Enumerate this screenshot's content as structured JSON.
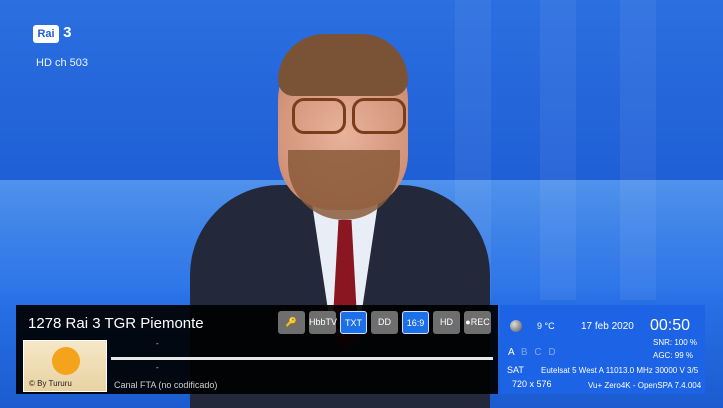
{
  "channel_logo": {
    "brand": "Rai",
    "number": "3"
  },
  "hd_channel": "HD ch 503",
  "infobar": {
    "channel": "1278 Rai 3 TGR Piemonte",
    "now": "-",
    "next": "-",
    "encryption": "Canal FTA (no codificado)",
    "picon_credit": "© By Tururu",
    "progress_fraction": 0.0,
    "icons": [
      {
        "name": "key-icon",
        "label": "🔑",
        "active": false
      },
      {
        "name": "hbbtv-icon",
        "label": "HbbTV",
        "active": false
      },
      {
        "name": "teletext-icon",
        "label": "TXT",
        "active": true
      },
      {
        "name": "dolby-icon",
        "label": "DD",
        "active": false
      },
      {
        "name": "aspect-icon",
        "label": "16:9",
        "active": true
      },
      {
        "name": "hd-icon",
        "label": "HD",
        "active": false
      },
      {
        "name": "rec-icon",
        "label": "●REC",
        "active": false
      }
    ]
  },
  "status": {
    "temperature": "9 °C",
    "date": "17 feb 2020",
    "time": "00:50",
    "tuners": [
      "A",
      "B",
      "C",
      "D"
    ],
    "active_tuner": "A",
    "snr": "SNR:  100 %",
    "agc": "AGC:  99 %",
    "sat_label": "SAT",
    "sat_info": "Eutelsat 5 West A 11013.0 MHz 30000 V 3/5",
    "resolution": "720 x 576",
    "box": "Vu+ Zero4K - OpenSPA 7.4.004"
  },
  "colors": {
    "panel_blue": "#1c63e6",
    "icon_active": "#1d6fe8",
    "icon_idle": "#6e6e6e"
  }
}
